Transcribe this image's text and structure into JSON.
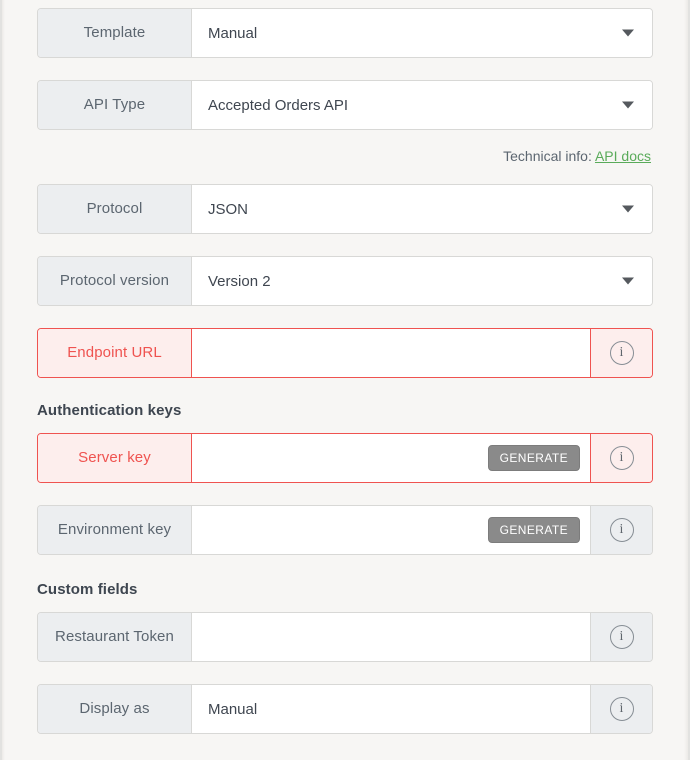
{
  "form": {
    "rows": [
      {
        "label": "Template",
        "value": "Manual",
        "type": "select",
        "state": "normal",
        "has_info": false
      },
      {
        "label": "API Type",
        "value": "Accepted Orders API",
        "type": "select",
        "state": "normal",
        "has_info": false
      }
    ],
    "technical_info": {
      "prefix": "Technical info:",
      "link_label": "API docs"
    },
    "protocol_rows": [
      {
        "label": "Protocol",
        "value": "JSON",
        "type": "select",
        "state": "normal",
        "has_info": false
      },
      {
        "label": "Protocol version",
        "value": "Version 2",
        "type": "select",
        "state": "normal",
        "has_info": false
      },
      {
        "label": "Endpoint URL",
        "value": "",
        "type": "text",
        "state": "error",
        "has_info": true
      }
    ],
    "auth_section": {
      "heading": "Authentication keys",
      "rows": [
        {
          "label": "Server key",
          "value": "",
          "type": "text",
          "state": "error",
          "has_info": true,
          "button_label": "GENERATE"
        },
        {
          "label": "Environment key",
          "value": "",
          "type": "text",
          "state": "normal",
          "has_info": true,
          "button_label": "GENERATE"
        }
      ]
    },
    "custom_section": {
      "heading": "Custom fields",
      "rows": [
        {
          "label": "Restaurant Token",
          "value": "",
          "type": "text",
          "state": "normal",
          "has_info": true
        },
        {
          "label": "Display as",
          "value": "Manual",
          "type": "text",
          "state": "normal",
          "has_info": true
        }
      ]
    }
  },
  "icons": {
    "info": "info-circle-icon",
    "caret": "chevron-down-icon"
  },
  "colors": {
    "error_red": "#ef5350",
    "link_green": "#5aab5a",
    "label_bg": "#eceef0",
    "page_bg": "#f7f6f4",
    "generate_gray": "#8a8a8a"
  },
  "glyphs": {
    "info": "i"
  }
}
